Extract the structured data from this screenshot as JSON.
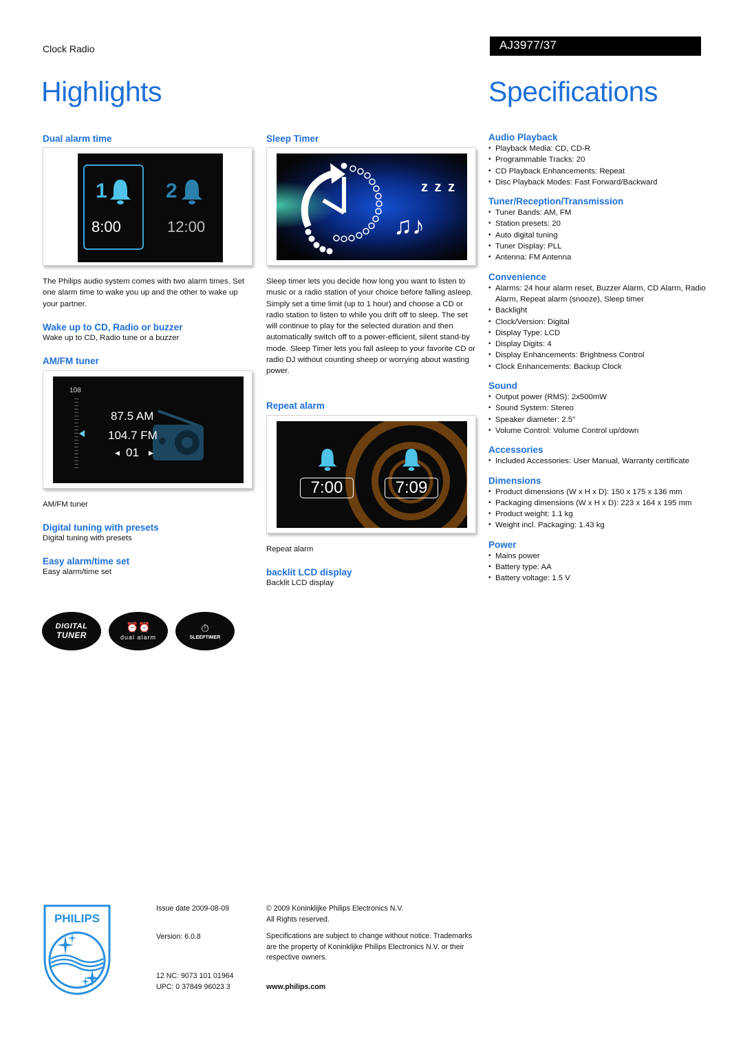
{
  "header": {
    "category": "Clock Radio",
    "model": "AJ3977/37",
    "highlights_title": "Highlights",
    "specifications_title": "Specifications"
  },
  "highlights": {
    "dual_alarm": {
      "title": "Dual alarm time",
      "image": {
        "alarm1_label": "1",
        "alarm1_time": "8:00",
        "alarm2_label": "2",
        "alarm2_time": "12:00"
      },
      "body": "The Philips audio system comes with two alarm times. Set one alarm time to wake you up and the other to wake up your partner."
    },
    "wake_up": {
      "title": "Wake up to CD, Radio or buzzer",
      "body": "Wake up to CD, Radio tune or a buzzer"
    },
    "amfm": {
      "title": "AM/FM tuner",
      "image": {
        "scale_top": "108",
        "am": "87.5 AM",
        "fm": "104.7 FM",
        "preset": "01"
      },
      "caption": "AM/FM tuner"
    },
    "digital_tuning": {
      "title": "Digital tuning with presets",
      "body": "Digital tuning with presets"
    },
    "easy_alarm": {
      "title": "Easy alarm/time set",
      "body": "Easy alarm/time set"
    },
    "sleep_timer": {
      "title": "Sleep Timer",
      "image": {
        "zzz": "z z z"
      },
      "body": "Sleep timer lets you decide how long you want to listen to music or a radio station of your choice before falling asleep. Simply set a time limit (up to 1 hour) and choose a CD or radio station to listen to while you drift off to sleep. The set will continue to play for the selected duration and then automatically switch off to a power-efficient, silent stand-by mode. Sleep Timer lets you fall asleep to your favorite CD or radio DJ without counting sheep or worrying about wasting power."
    },
    "repeat_alarm": {
      "title": "Repeat alarm",
      "image": {
        "time1": "7:00",
        "time2": "7:09"
      },
      "caption": "Repeat alarm"
    },
    "backlit": {
      "title": "backlit LCD display",
      "body": "Backlit LCD display"
    },
    "badges": [
      {
        "line1": "DIGITAL",
        "line2": "TUNER"
      },
      {
        "line1": "dual alarm"
      },
      {
        "line1": "SLEEPTIMER"
      }
    ]
  },
  "specifications": [
    {
      "title": "Audio Playback",
      "items": [
        "Playback Media: CD, CD-R",
        "Programmable Tracks: 20",
        "CD Playback Enhancements: Repeat",
        "Disc Playback Modes: Fast Forward/Backward"
      ]
    },
    {
      "title": "Tuner/Reception/Transmission",
      "items": [
        "Tuner Bands: AM, FM",
        "Station presets: 20",
        "Auto digital tuning",
        "Tuner Display: PLL",
        "Antenna: FM Antenna"
      ]
    },
    {
      "title": "Convenience",
      "items": [
        "Alarms: 24 hour alarm reset, Buzzer Alarm, CD Alarm, Radio Alarm, Repeat alarm (snooze), Sleep timer",
        "Backlight",
        "Clock/Version: Digital",
        "Display Type: LCD",
        "Display Digits: 4",
        "Display Enhancements: Brightness Control",
        "Clock Enhancements: Backup Clock"
      ]
    },
    {
      "title": "Sound",
      "items": [
        "Output power (RMS): 2x500mW",
        "Sound System: Stereo",
        "Speaker diameter: 2.5\"",
        "Volume Control: Volume Control up/down"
      ]
    },
    {
      "title": "Accessories",
      "items": [
        "Included Accessories: User Manual, Warranty certificate"
      ]
    },
    {
      "title": "Dimensions",
      "items": [
        "Product dimensions (W x H x D): 150 x 175 x 136 mm",
        "Packaging dimensions (W x H x D): 223 x 164 x 195 mm",
        "Product weight: 1.1 kg",
        "Weight incl. Packaging: 1.43 kg"
      ]
    },
    {
      "title": "Power",
      "items": [
        "Mains power",
        "Battery type: AA",
        "Battery voltage: 1.5 V"
      ]
    }
  ],
  "footer": {
    "logo_text": "PHILIPS",
    "issue_date": "Issue date 2009-08-09",
    "version": "Version: 6.0.8",
    "nc": "12 NC: 9073 101 01964",
    "upc": "UPC: 0 37849 96023 3",
    "copyright": "© 2009 Koninklijke Philips Electronics N.V.",
    "rights": "All Rights reserved.",
    "disclaimer": "Specifications are subject to change without notice. Trademarks are the property of Koninklijke Philips Electronics N.V. or their respective owners.",
    "website": "www.philips.com"
  },
  "colors": {
    "accent": "#1d6fd8",
    "lcd_cyan": "#4fc3e8",
    "repeat_ring": "#7a4a12"
  }
}
